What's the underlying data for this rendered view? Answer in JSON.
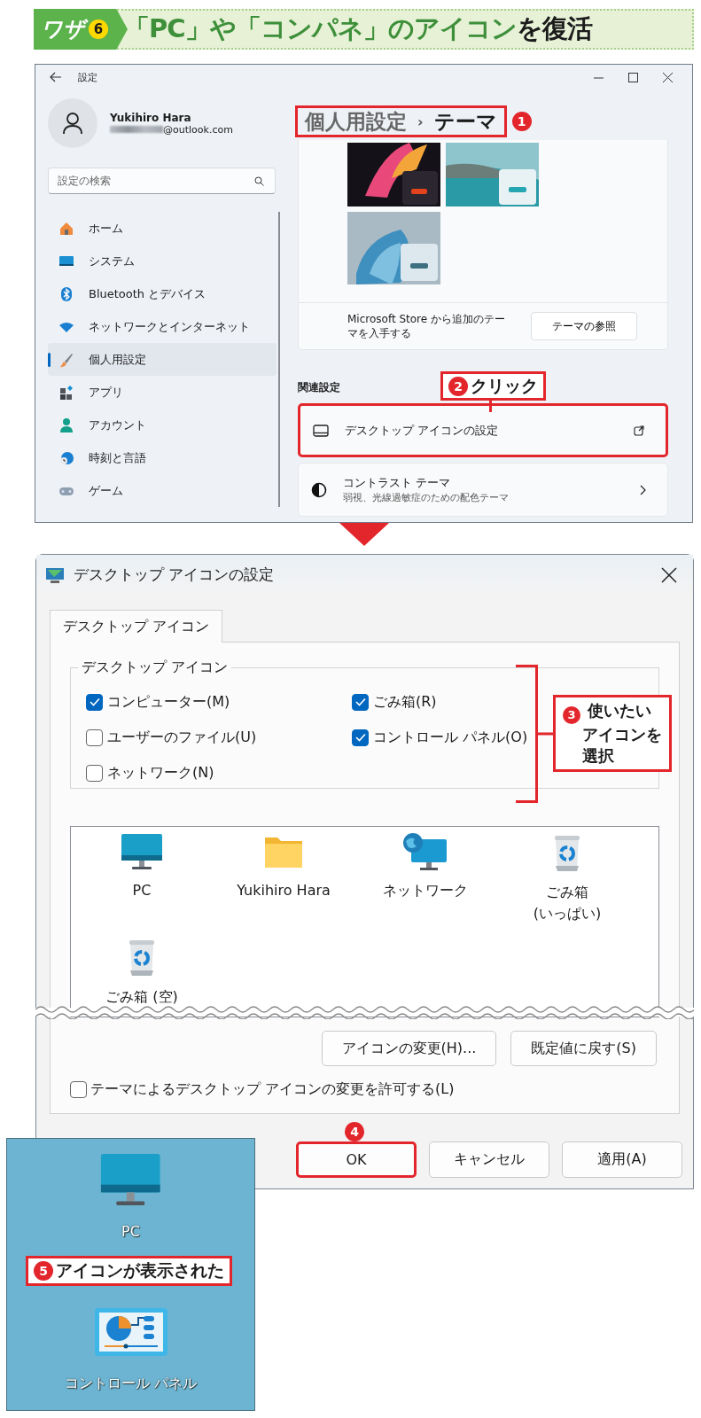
{
  "header": {
    "badge": "ワザ",
    "number": "6",
    "title": [
      {
        "text": "「PC」や「コンパネ」のアイコン",
        "accent": true
      },
      {
        "text": "を復活",
        "accent": false
      }
    ]
  },
  "settings": {
    "title": "設定",
    "account": {
      "name": "Yukihiro Hara",
      "email": "@outlook.com"
    },
    "search": {
      "placeholder": "設定の検索"
    },
    "nav": [
      {
        "label": "ホーム",
        "selected": false
      },
      {
        "label": "システム",
        "selected": false
      },
      {
        "label": "Bluetooth とデバイス",
        "selected": false
      },
      {
        "label": "ネットワークとインターネット",
        "selected": false
      },
      {
        "label": "個人用設定",
        "selected": true
      },
      {
        "label": "アプリ",
        "selected": false
      },
      {
        "label": "アカウント",
        "selected": false
      },
      {
        "label": "時刻と言語",
        "selected": false
      },
      {
        "label": "ゲーム",
        "selected": false
      }
    ],
    "breadcrumb": [
      {
        "text": "個人用設定",
        "current": false
      },
      {
        "text": "テーマ",
        "current": true
      }
    ],
    "breadcrumb_separator": "›",
    "store": {
      "text": "Microsoft Store から追加のテーマを入手する",
      "button": "テーマの参照"
    },
    "related": {
      "heading": "関連設定",
      "items": [
        {
          "title": "デスクトップ アイコンの設定",
          "kind": "external"
        },
        {
          "title": "コントラスト テーマ",
          "subtitle": "弱視、光線過敏症のための配色テーマ",
          "kind": "chevron"
        }
      ]
    }
  },
  "dialog": {
    "title": "デスクトップ アイコンの設定",
    "tabs": [
      {
        "label": "デスクトップ アイコン",
        "selected": true
      }
    ],
    "group": {
      "legend": "デスクトップ アイコン",
      "options": [
        {
          "label": "コンピューター(M)",
          "checked": true
        },
        {
          "label": "ごみ箱(R)",
          "checked": true
        },
        {
          "label": "ユーザーのファイル(U)",
          "checked": false
        },
        {
          "label": "コントロール パネル(O)",
          "checked": true
        },
        {
          "label": "ネットワーク(N)",
          "checked": false
        }
      ]
    },
    "icons": [
      {
        "label": "PC",
        "kind": "monitor"
      },
      {
        "label": "Yukihiro Hara",
        "kind": "folder"
      },
      {
        "label": "ネットワーク",
        "kind": "network"
      },
      {
        "label": "ごみ箱\n(いっぱい)",
        "kind": "bin"
      },
      {
        "label": "ごみ箱 (空)",
        "kind": "bin"
      }
    ],
    "actions": [
      "アイコンの変更(H)...",
      "既定値に戻す(S)"
    ],
    "allow_themes": {
      "label": "テーマによるデスクトップ アイコンの変更を許可する(L)",
      "checked": false
    },
    "buttons": [
      {
        "label": "OK",
        "highlighted": true
      },
      {
        "label": "キャンセル",
        "highlighted": false
      },
      {
        "label": "適用(A)",
        "highlighted": false
      }
    ]
  },
  "desktop": {
    "items": [
      {
        "label": "PC",
        "kind": "monitor"
      },
      {
        "label": "コントロール パネル",
        "kind": "control-panel"
      }
    ]
  },
  "annotations": [
    {
      "number": "1"
    },
    {
      "number": "2",
      "text": "クリック"
    },
    {
      "number": "3",
      "text": "使いたいアイコンを選択"
    },
    {
      "number": "4"
    },
    {
      "number": "5",
      "text": "アイコンが表示された"
    }
  ]
}
